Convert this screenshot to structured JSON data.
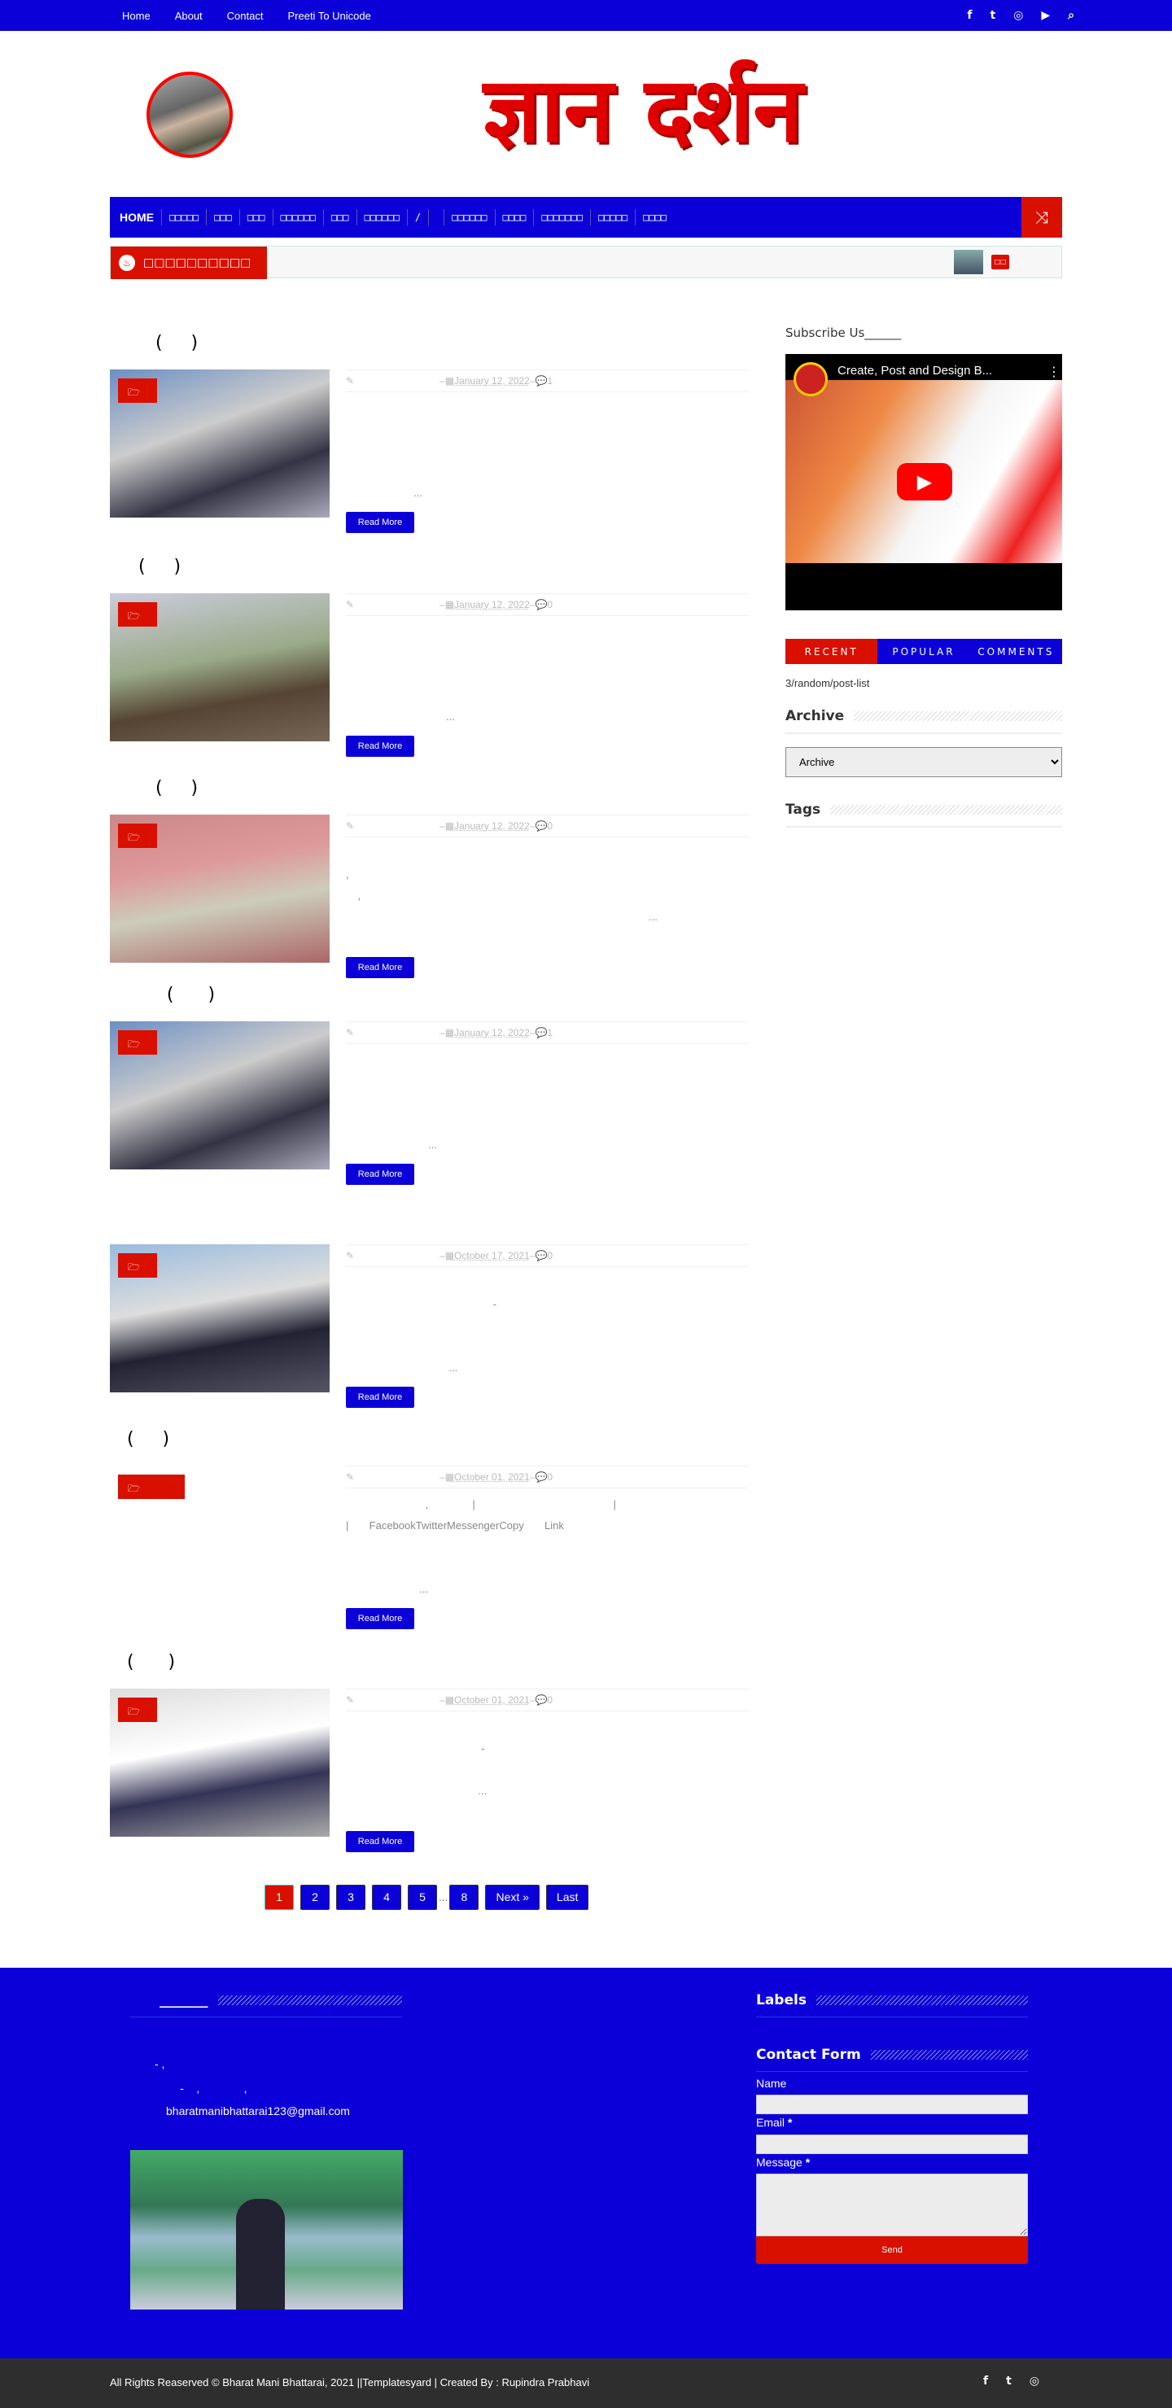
{
  "colors": {
    "primary": "#0c00d8",
    "accent": "#d90f00",
    "footer_bottom": "#2e2e2e"
  },
  "topbar": {
    "links": [
      "Home",
      "About",
      "Contact",
      "Preeti To Unicode"
    ],
    "icons": [
      "facebook-icon",
      "twitter-icon",
      "instagram-icon",
      "youtube-icon",
      "search-icon"
    ]
  },
  "header": {
    "logo_text": "ज्ञान दर्शन"
  },
  "nav": {
    "items": [
      "HOME",
      "□□□□□",
      "□□□",
      "□□□",
      "□□□□□□",
      "□□□",
      "□□□□□□",
      "/",
      "",
      "□□□□□□",
      "□□□□",
      "□□□□□□□",
      "□□□□□",
      "□□□□"
    ],
    "shuffle_icon": "shuffle-icon"
  },
  "ticker": {
    "label": "□□□□□□□□□□",
    "badge": "□□"
  },
  "posts": [
    {
      "title": "        (     )",
      "date": "January 12, 2022",
      "comments": "1",
      "excerpt": "\n\n\n\n                       ...",
      "read_more": "Read More"
    },
    {
      "title": "     (     )",
      "date": "January 12, 2022",
      "comments": "0",
      "excerpt": "\n\n\n\n                                  ...",
      "read_more": "Read More"
    },
    {
      "title": "        (     )",
      "date": "January 12, 2022",
      "comments": "0",
      "excerpt": "\n,\n    ,\n                                                                                                       ...",
      "read_more": "Read More"
    },
    {
      "title": "          (      )",
      "date": "January 12, 2022",
      "comments": "1",
      "excerpt": "\n\n\n\n                            ...",
      "read_more": "Read More"
    },
    {
      "title": "",
      "date": "October 17, 2021",
      "comments": "0",
      "excerpt": "\n                                                  -\n\n\n                                   ...",
      "read_more": "Read More"
    },
    {
      "title": "   (     )",
      "date": "October 01, 2021",
      "comments": "0",
      "excerpt": "                           ,               |                                               |\n|       FacebookTwitterMessengerCopy       Link\n\n\n                         ...",
      "read_more": "Read More"
    },
    {
      "title": "   (      )",
      "date": "October 01, 2021",
      "comments": "0",
      "excerpt": "\n                                              -\n\n                                             ...",
      "read_more": "Read More"
    }
  ],
  "pagination": {
    "pages": [
      "1",
      "2",
      "3",
      "4",
      "5"
    ],
    "dots": "...",
    "last_page": "8",
    "next": "Next »",
    "last": "Last",
    "current": "1"
  },
  "sidebar": {
    "subscribe_title": "Subscribe Us______",
    "video_title": "Create, Post and Design B...",
    "tabs": [
      "RECENT",
      "POPULAR",
      "COMMENTS"
    ],
    "tab_content": "3/random/post-list",
    "archive_title": "Archive",
    "archive_select": "Archive",
    "tags_title": "Tags"
  },
  "footer": {
    "about_title": "_______",
    "about_lines": [
      "- ,",
      "        -    ,              ,"
    ],
    "email": "bharatmanibhattarai123@gmail.com",
    "labels_title": "Labels",
    "contact_title": "Contact Form",
    "name_label": "Name",
    "email_label": "Email",
    "message_label": "Message",
    "required": "*",
    "send": "Send",
    "copyright": "All Rights Reaserved © Bharat Mani Bhattarai, 2021 ||Templatesyard | Created By : Rupindra Prabhavi",
    "social_icons": [
      "facebook-icon",
      "twitter-icon",
      "instagram-icon"
    ]
  }
}
